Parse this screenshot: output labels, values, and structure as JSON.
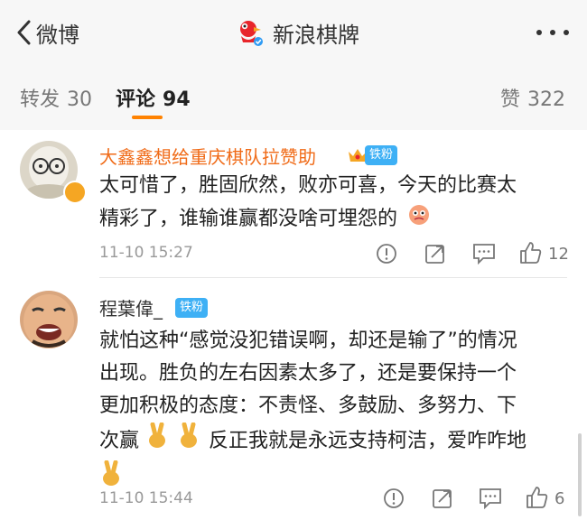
{
  "header": {
    "back_label": "微博",
    "account_name": "新浪棋牌"
  },
  "tabs": [
    {
      "label": "转发",
      "count": "30"
    },
    {
      "label": "评论",
      "count": "94"
    },
    {
      "label": "赞",
      "count": "322"
    }
  ],
  "comments": [
    {
      "username": "大鑫鑫想给重庆棋队拉赞助",
      "badge": "铁粉",
      "text_line1": "太可惜了，胜固欣然，败亦可喜，今天的比赛太",
      "text_line2": "精彩了，谁输谁赢都没啥可埋怨的",
      "time": "11-10 15:27",
      "likes": "12"
    },
    {
      "username": "程葉偉_",
      "badge": "铁粉",
      "text_line1": "就怕这种“感觉没犯错误啊，却还是输了”的情况",
      "text_line2": "出现。胜负的左右因素太多了，还是要保持一个",
      "text_line3": "更加积极的态度：不责怪、多鼓励、多努力、下",
      "text_line4a": "次赢",
      "text_line4b": "反正我就是永远支持柯洁，爱咋咋地",
      "time": "11-10 15:44",
      "likes": "6"
    }
  ],
  "colors": {
    "accent": "#ff8200",
    "vip_username": "#f06b18",
    "badge": "#3eb0f5",
    "verified": "#2f9bf4"
  },
  "icons": [
    "back-chevron-icon",
    "sina-chess-logo-icon",
    "more-icon",
    "report-icon",
    "repost-icon",
    "comment-icon",
    "like-icon",
    "victory-hand-emoji",
    "face-emoji",
    "crown-icon"
  ]
}
